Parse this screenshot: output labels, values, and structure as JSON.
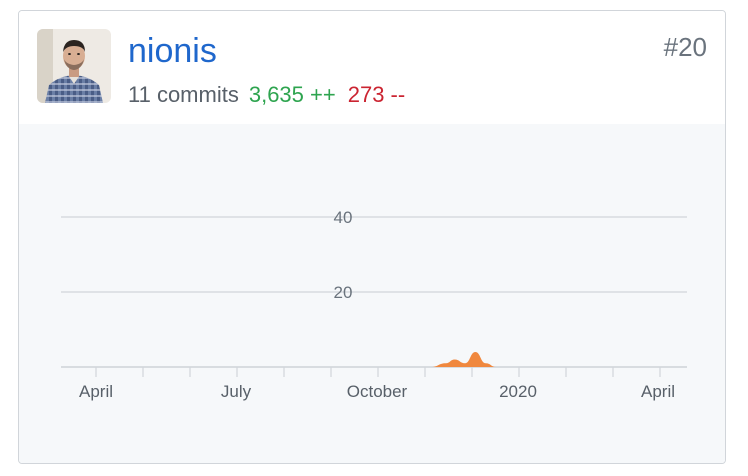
{
  "contributor": {
    "username": "nionis",
    "rank": "#20",
    "commits": "11 commits",
    "additions": "3,635 ++",
    "deletions": "273 --"
  },
  "colors": {
    "link": "#1f67cc",
    "additions": "#2ea44f",
    "deletions": "#cb2431",
    "area": "#f0883e"
  },
  "chart_data": {
    "type": "area",
    "y_ticks": [
      "20",
      "40"
    ],
    "x_ticks": [
      "April",
      "July",
      "October",
      "2020",
      "April"
    ],
    "grid": true,
    "series": [
      {
        "x": [
          "2019-11-15",
          "2019-11-25",
          "2019-12-01",
          "2019-12-08",
          "2019-12-15",
          "2019-12-22",
          "2019-12-29",
          "2020-01-05"
        ],
        "values": [
          0,
          1,
          2,
          1,
          4,
          1,
          0,
          0
        ]
      }
    ]
  }
}
